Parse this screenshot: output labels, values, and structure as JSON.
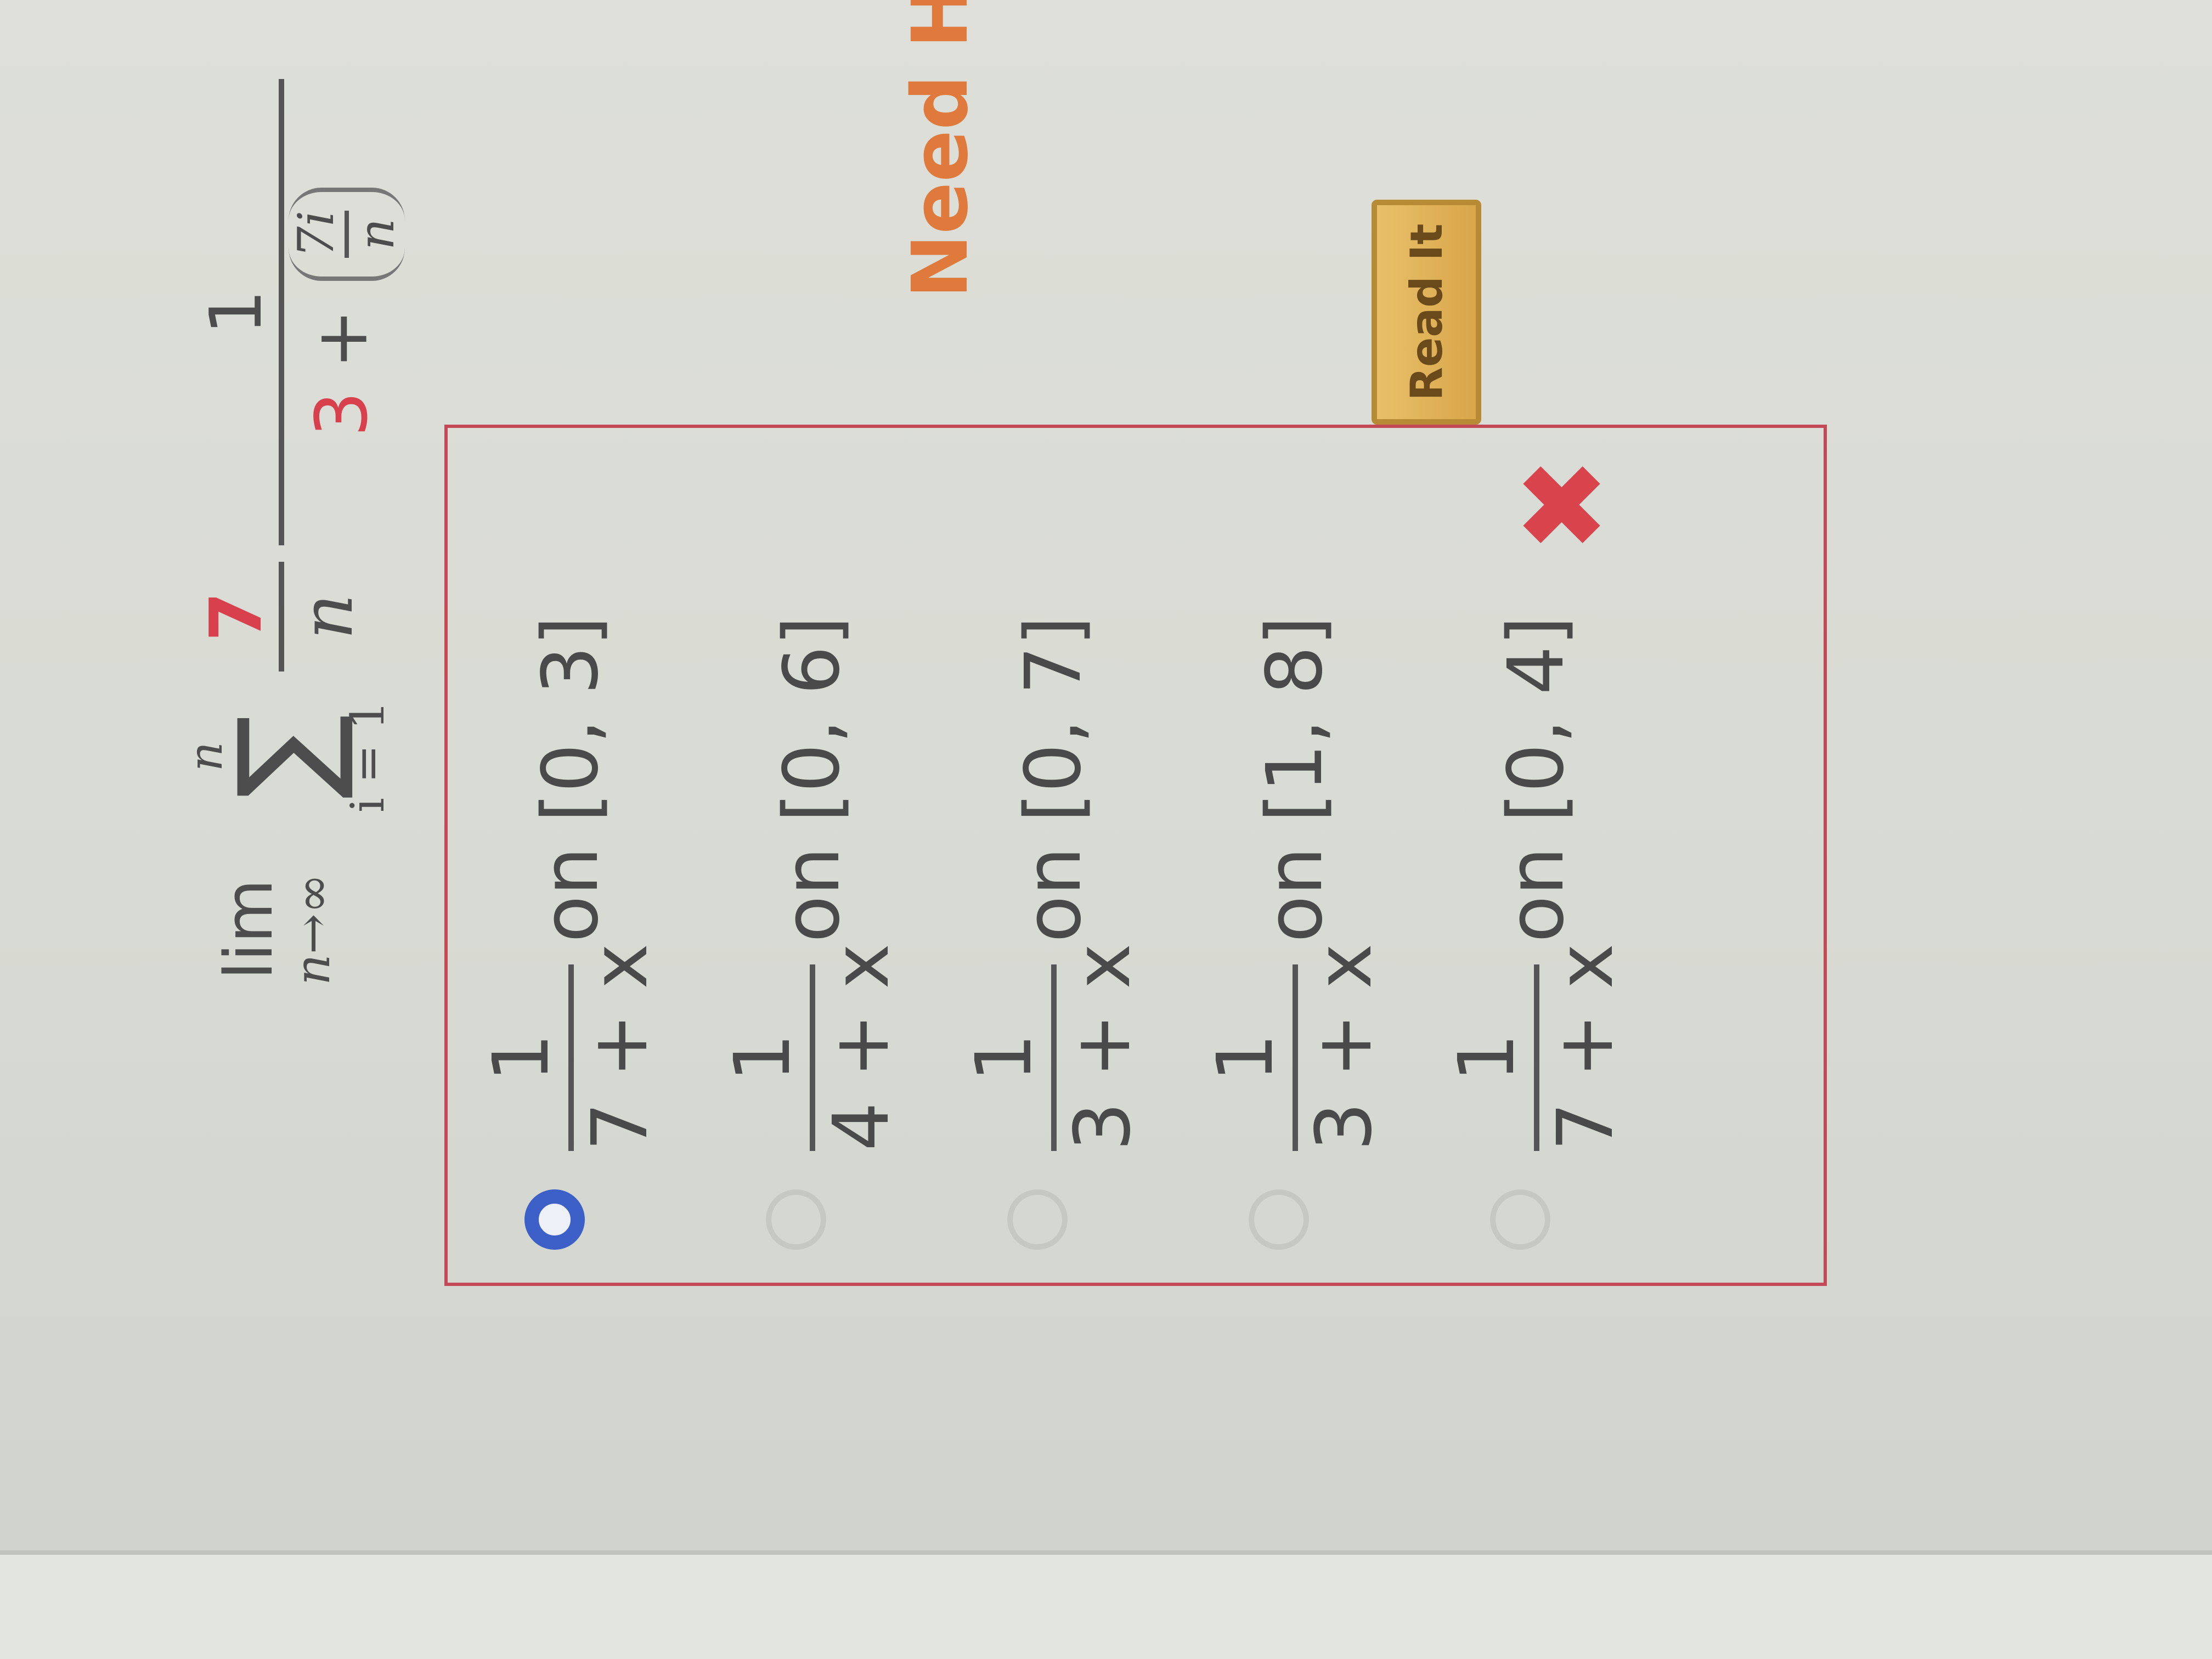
{
  "expression": {
    "lim_word": "lim",
    "lim_sub": "n→∞",
    "sum_upper": "n",
    "sum_symbol": "∑",
    "sum_lower": "i = 1",
    "coef_num": "7",
    "coef_den": "n",
    "term_num": "1",
    "term_den_const": "3",
    "term_den_plus": "+",
    "inner_num": "7i",
    "inner_den": "n"
  },
  "choices": [
    {
      "num": "1",
      "den": "7 + x",
      "interval": "on [0, 3]",
      "selected": true
    },
    {
      "num": "1",
      "den": "4 + x",
      "interval": "on [0, 6]",
      "selected": false
    },
    {
      "num": "1",
      "den": "3 + x",
      "interval": "on [0, 7]",
      "selected": false
    },
    {
      "num": "1",
      "den": "3 + x",
      "interval": "on [1, 8]",
      "selected": false
    },
    {
      "num": "1",
      "den": "7 + x",
      "interval": "on [0, 4]",
      "selected": false
    }
  ],
  "feedback": {
    "mark": "✖"
  },
  "footer": {
    "need_help": "Need Help?",
    "read_it": "Read It"
  },
  "colors": {
    "accent_red": "#d8404d",
    "radio_selected": "#3d5fc8",
    "help_orange": "#e07a3c",
    "button_gold": "#d9a64a"
  }
}
